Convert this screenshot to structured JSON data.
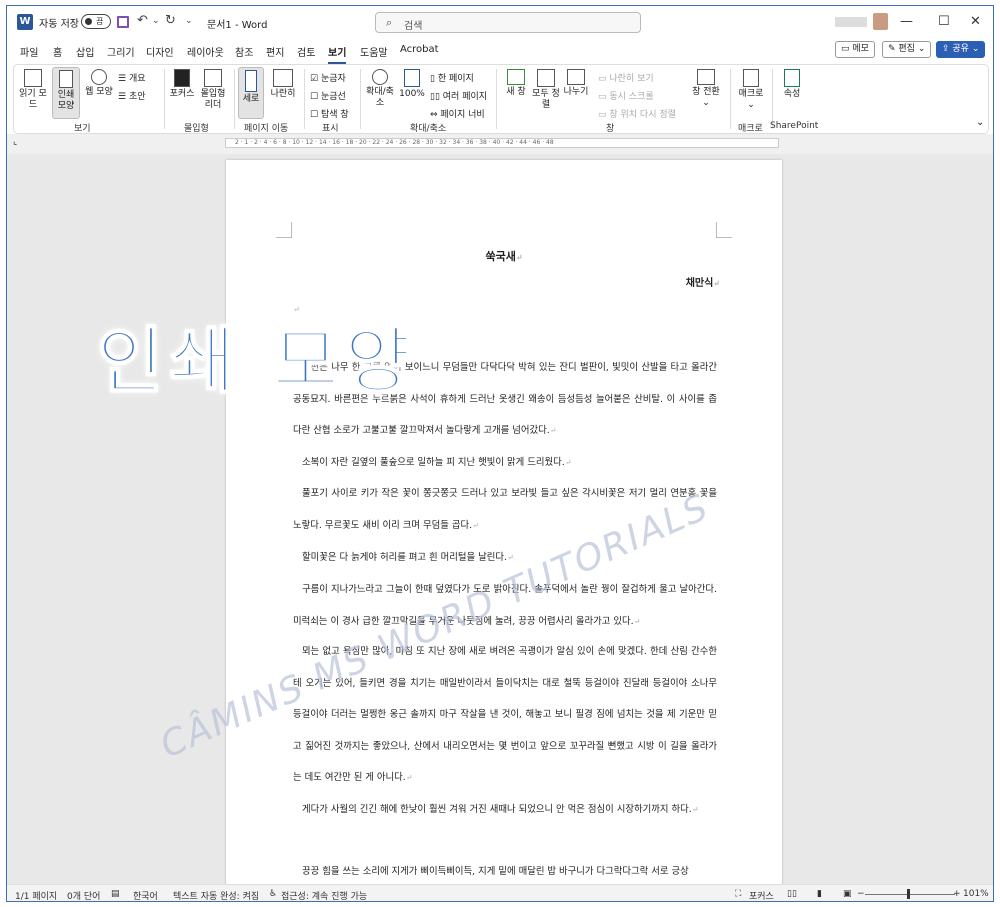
{
  "titlebar": {
    "app_icon": "W",
    "autosave_label": "자동 저장",
    "autosave_state": "끔",
    "undo_icon": "undo-icon",
    "doc_title": "문서1 - Word",
    "search_placeholder": "검색",
    "minimize": "—",
    "maximize": "☐",
    "close": "✕"
  },
  "menu": [
    "파일",
    "홈",
    "삽입",
    "그리기",
    "디자인",
    "레이아웃",
    "참조",
    "편지",
    "검토",
    "보기",
    "도움말",
    "Acrobat"
  ],
  "active_tab": "보기",
  "right_buttons": {
    "memo": "메모",
    "edit": "편집",
    "share": "공유"
  },
  "ribbon": {
    "read_mode": "읽기 모드",
    "print_layout": "인쇄 모양",
    "web_layout": "웹 모양",
    "outline": "개요",
    "draft": "초안",
    "group_view": "보기",
    "focus": "포커스",
    "immersive_reader": "몰입형 리더",
    "group_immersive": "몰입형",
    "vertical": "세로",
    "side_to_side": "나란히",
    "group_page_move": "페이지 이동",
    "ruler": "눈금자",
    "gridlines": "눈금선",
    "nav_pane": "탐색 창",
    "group_show": "표시",
    "zoom": "확대/축소",
    "hundred": "100%",
    "one_page": "한 페이지",
    "multi_page": "여러 페이지",
    "page_width": "페이지 너비",
    "group_zoom": "확대/축소",
    "new_window": "새 창",
    "arrange_all": "모두 정렬",
    "split": "나누기",
    "side_by_side": "나란히 보기",
    "sync_scroll": "동시 스크롤",
    "reset_pos": "창 위치 다시 정렬",
    "switch_windows": "창 전환",
    "group_window": "창",
    "macros": "매크로",
    "group_macros": "매크로",
    "properties": "속성",
    "group_sharepoint": "SharePoint"
  },
  "ruler_numbers": "2 · 1 · 2 · 4 · 6 · 8 · 10 · 12 · 14 · 16 · 18 · 20 · 22 · 24 · 26 · 28 · 30 · 32 · 34 · 36 · 38 · 40 · 42 · 44 · 46 · 48",
  "document": {
    "title": "쑥국새",
    "author": "채만식",
    "section": "1",
    "paragraphs": [
      "왼편은 나무 한 그루 없어 보이느니 무덤들만 다닥다닥 박혀 있는 잔디 벌판이, 빛밋이 산발을 타고 올라간 공동묘지. 바른편은 누르붉은 사석이 휴하게 드러난 옷생긴 왜송이 듬성듬성 늘어붙은 산비탈. 이 사이를 좁다란 산협 소로가 고불고불 깔끄막져서 놀다랗게 고개를 넘어갔다.",
      "소복이 자란 길옆의 풀숲으로 일하늘 피 지난 햇빛이 맑게 드리웠다.",
      "풀포기 사이로 키가 작은 꽃이 쫑긋쫑긋 드러나 있고 보라빛 들고 싶은 각시비꽃은 저기 멀리 연분홍 꽃을 노랗다. 무르꽃도 새비 이리 크며 무덤들 곱다.",
      "할미꽃은 다 늙게야 허리를 펴고 흰 머리털을 날린다.",
      "구름이 지나가느라고 그늘이 한때 덮였다가 도로 밝아진다. 솔푸덕에서 놀란 꿩이 잘겁하게 울고 날아간다. 미럭쇠는 이 경사 급한 깔끄막길을 무거운 나뭇짐에 눌려, 끙끙 어렵사리 올라가고 있다.",
      "뫼는 없고 욕심만 많아, 마침 또 지난 장에 새로 벼려온 곡괭이가 알심 있이 손에 맞겠다. 한데 산림 간수한테 오기는 있어, 들키면 경을 치기는 매일반이라서 들이닥치는 대로 철뚝 등걸이야 진달래 등걸이야 소나무 등걸이야 더러는 멀쩡한 옹근 솔까지 마구 작살을 낸 것이, 해놓고 보니 필경 짐에 넘치는 것을 제 기운만 믿고 짊어진 것까지는 좋았으나, 산에서 내리오면서는 몇 번이고 앞으로 꼬꾸라질 뻔했고 시방 이 길을 올라가는 데도 여간만 된 게 아니다.",
      "게다가 사월의 긴긴 해에 한낮이 훨씬 겨워 거진 새때나 되었으니 안 먹은 점심이 시장하기까지 하다.",
      "끙끙 힘을 쓰는 소리에 지게가 삐이득삐이득, 지게 밑에 매달린 밥 바구니가 다그락다그락 서로 긍상"
    ]
  },
  "overlay": {
    "caption": "인쇄 모양",
    "watermark": "CÂMINS MS WORD TUTORIALS"
  },
  "status": {
    "page": "1/1 페이지",
    "words": "0개 단어",
    "lang": "한국어",
    "autocomplete": "텍스트 자동 완성: 켜짐",
    "accessibility": "접근성: 계속 진행 가능",
    "focus": "포커스",
    "zoom": "101%",
    "zoom_fraction": 0.5
  }
}
